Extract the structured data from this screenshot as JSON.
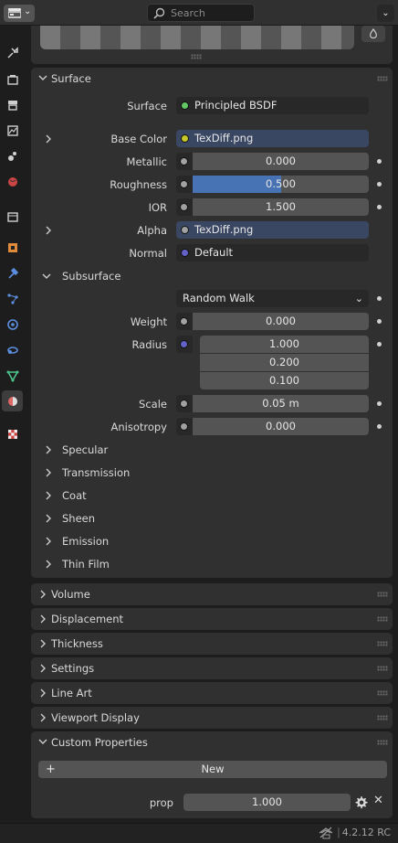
{
  "header": {
    "search_placeholder": "Search"
  },
  "sidebar_tabs": [
    {
      "icon": "tool-icon"
    },
    {
      "icon": "render-icon"
    },
    {
      "icon": "output-icon"
    },
    {
      "icon": "view-layer-icon"
    },
    {
      "icon": "scene-icon"
    },
    {
      "icon": "world-icon"
    },
    {
      "icon": "collection-icon"
    },
    {
      "icon": "object-icon"
    },
    {
      "icon": "modifier-icon"
    },
    {
      "icon": "particles-icon"
    },
    {
      "icon": "physics-icon"
    },
    {
      "icon": "constraints-icon"
    },
    {
      "icon": "data-icon"
    },
    {
      "icon": "material-icon",
      "active": true
    },
    {
      "icon": "texture-icon"
    }
  ],
  "surface_panel": {
    "title": "Surface",
    "surface_label": "Surface",
    "surface_value": "Principled BSDF",
    "base_color_label": "Base Color",
    "base_color_value": "TexDiff.png",
    "metallic_label": "Metallic",
    "metallic_value": "0.000",
    "roughness_label": "Roughness",
    "roughness_value": "0.500",
    "roughness_fraction": 0.5,
    "ior_label": "IOR",
    "ior_value": "1.500",
    "alpha_label": "Alpha",
    "alpha_value": "TexDiff.png",
    "normal_label": "Normal",
    "normal_value": "Default",
    "subsurface": {
      "title": "Subsurface",
      "method": "Random Walk",
      "weight_label": "Weight",
      "weight_value": "0.000",
      "radius_label": "Radius",
      "radius_values": [
        "1.000",
        "0.200",
        "0.100"
      ],
      "scale_label": "Scale",
      "scale_value": "0.05 m",
      "anisotropy_label": "Anisotropy",
      "anisotropy_value": "0.000"
    },
    "subpanels": [
      "Specular",
      "Transmission",
      "Coat",
      "Sheen",
      "Emission",
      "Thin Film"
    ]
  },
  "collapsed_panels": [
    "Volume",
    "Displacement",
    "Thickness",
    "Settings",
    "Line Art",
    "Viewport Display"
  ],
  "custom_properties": {
    "title": "Custom Properties",
    "new_label": "New",
    "prop_label": "prop",
    "prop_value": "1.000"
  },
  "footer": {
    "version": "4.2.12 RC"
  },
  "colors": {
    "socket_shader": "#63c763",
    "socket_color": "#c7c729",
    "socket_float": "#a1a1a1",
    "socket_vector": "#6363c7",
    "field_linked": "#3a4763",
    "slider_fill": "#4772b3"
  }
}
